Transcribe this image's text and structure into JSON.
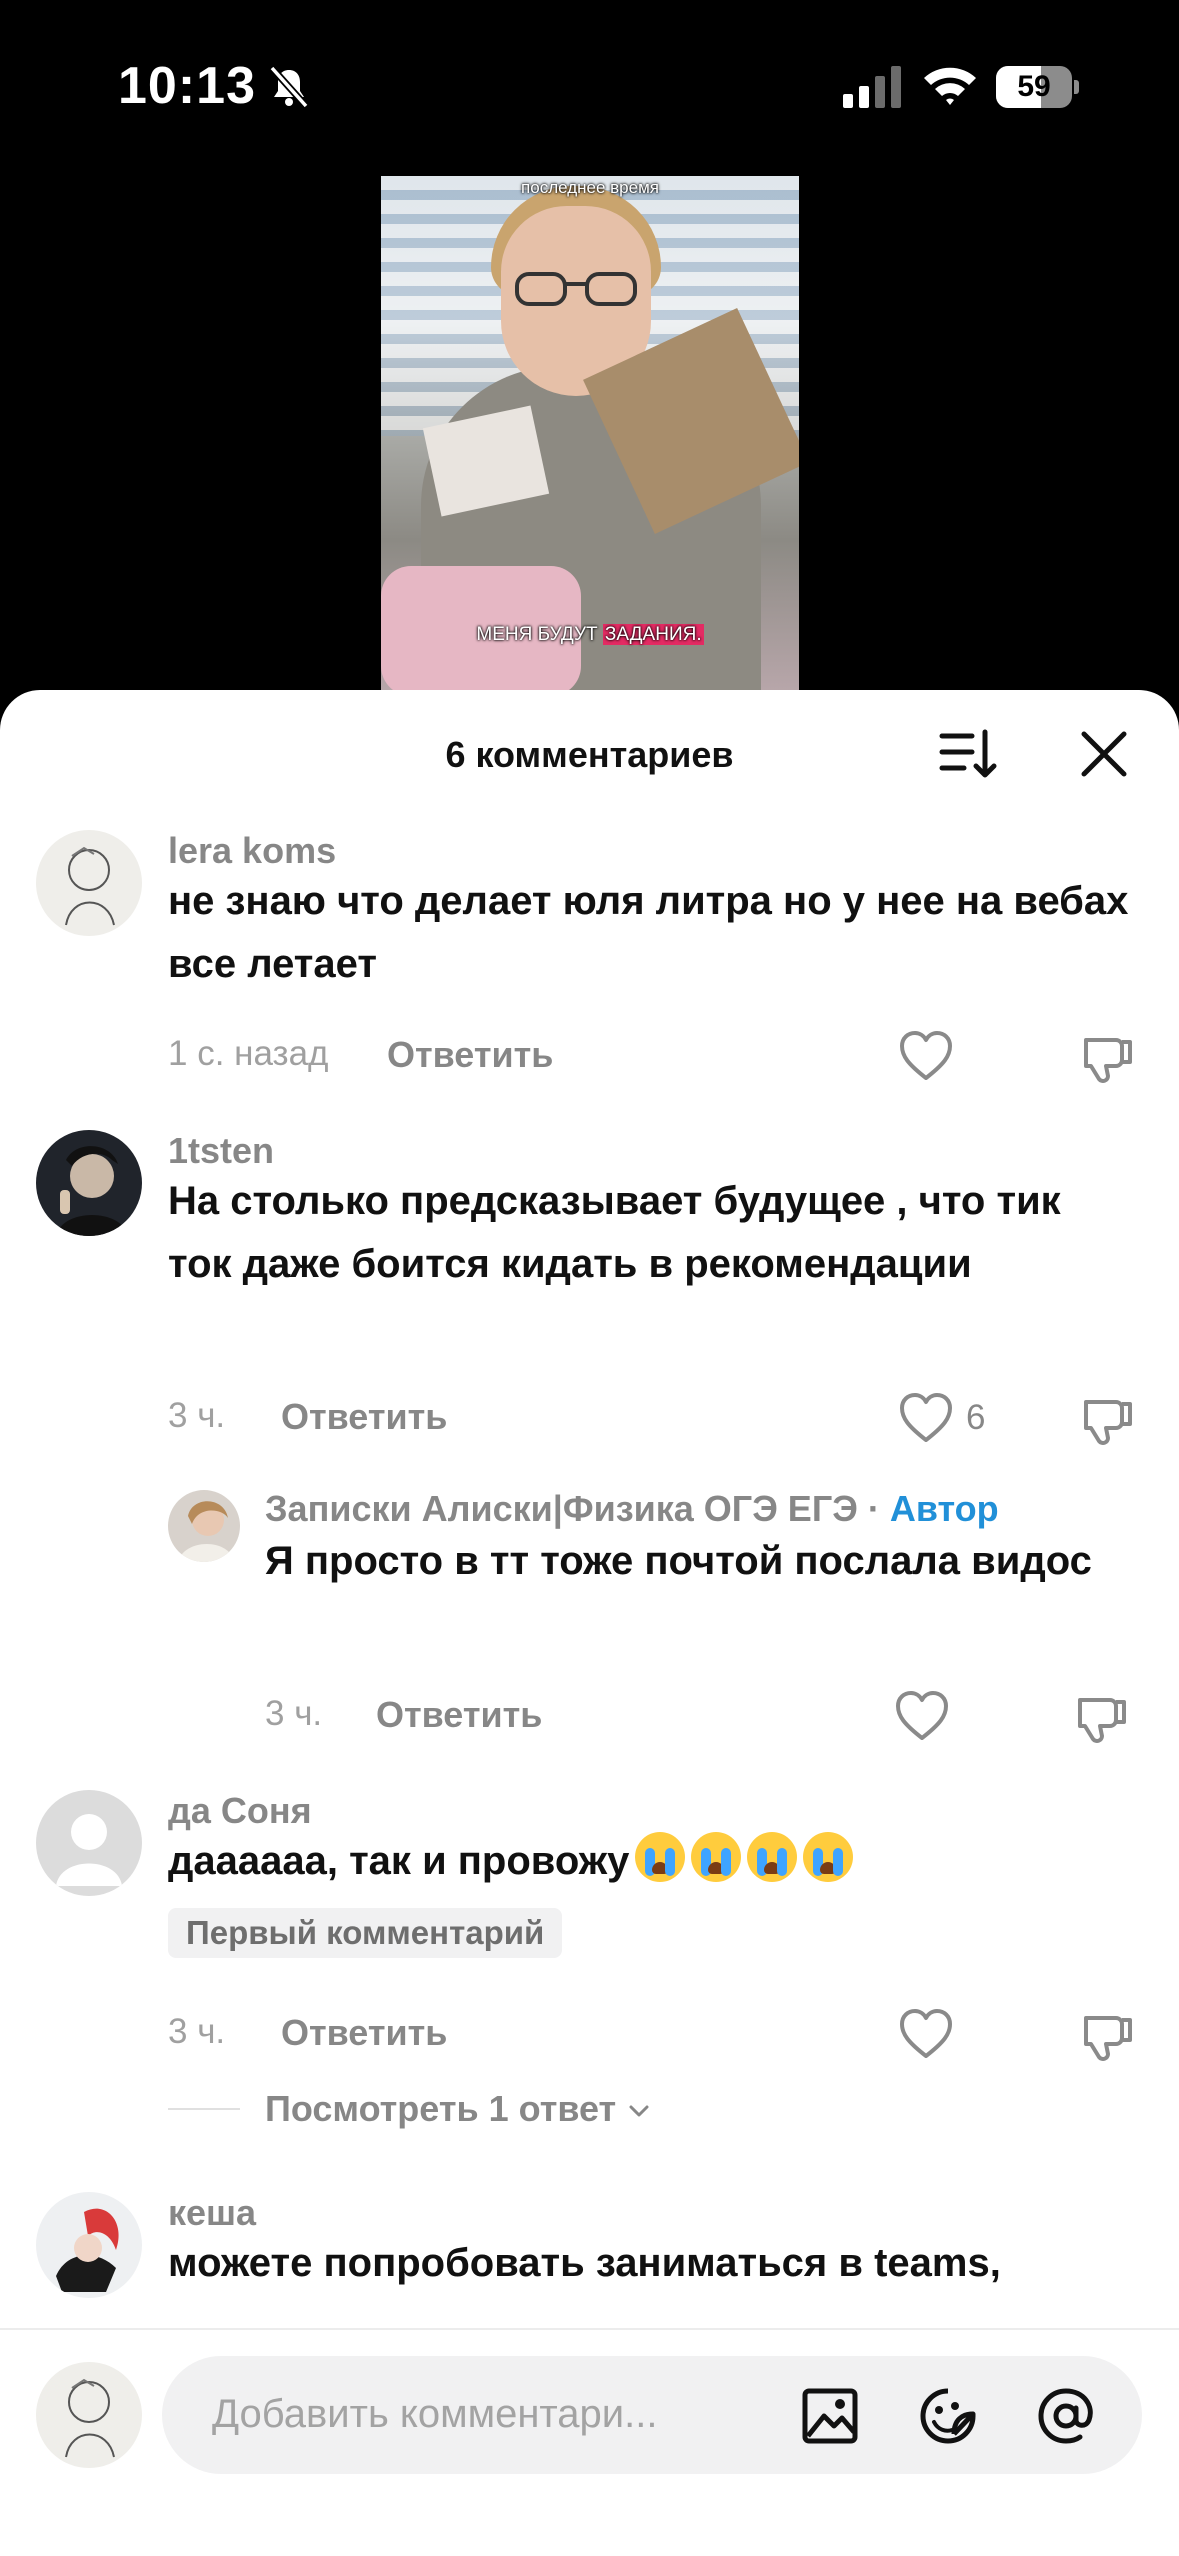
{
  "status_bar": {
    "time": "10:13",
    "battery": "59",
    "battery_level": 0.59
  },
  "video": {
    "caption_top": "последнее время",
    "caption_bottom_pre": "МЕНЯ БУДУТ ",
    "caption_bottom_hl": "ЗАДАНИЯ."
  },
  "sheet": {
    "title": "6 комментариев"
  },
  "comments": [
    {
      "user": "lera koms",
      "text": "не знаю что делает юля литра но у нее на вебах все летает",
      "time": "1 с. назад",
      "reply": "Ответить",
      "likes": ""
    },
    {
      "user": "1tsten",
      "text": "На столько предсказывает будущее , что тик ток даже боится кидать в рекомендации",
      "time": "3 ч.",
      "reply": "Ответить",
      "likes": "6"
    },
    {
      "user": "Записки Алиски|Физика ОГЭ ЕГЭ",
      "author_sep": "·",
      "author_tag": "Автор",
      "text": "Я просто в тт тоже почтой послала видос",
      "time": "3 ч.",
      "reply": "Ответить",
      "likes": ""
    },
    {
      "user": "да Соня",
      "text": "дааааaа, так и провожу",
      "badge": "Первый комментарий",
      "time": "3 ч.",
      "reply": "Ответить",
      "likes": "",
      "view_replies": "Посмотреть 1 ответ"
    },
    {
      "user": "кеша",
      "text": "можете попробовать заниматься в teams,"
    }
  ],
  "input": {
    "placeholder": "Добавить комментари..."
  },
  "colors": {
    "accent_author": "#2190d8",
    "highlight": "#e32b63"
  }
}
